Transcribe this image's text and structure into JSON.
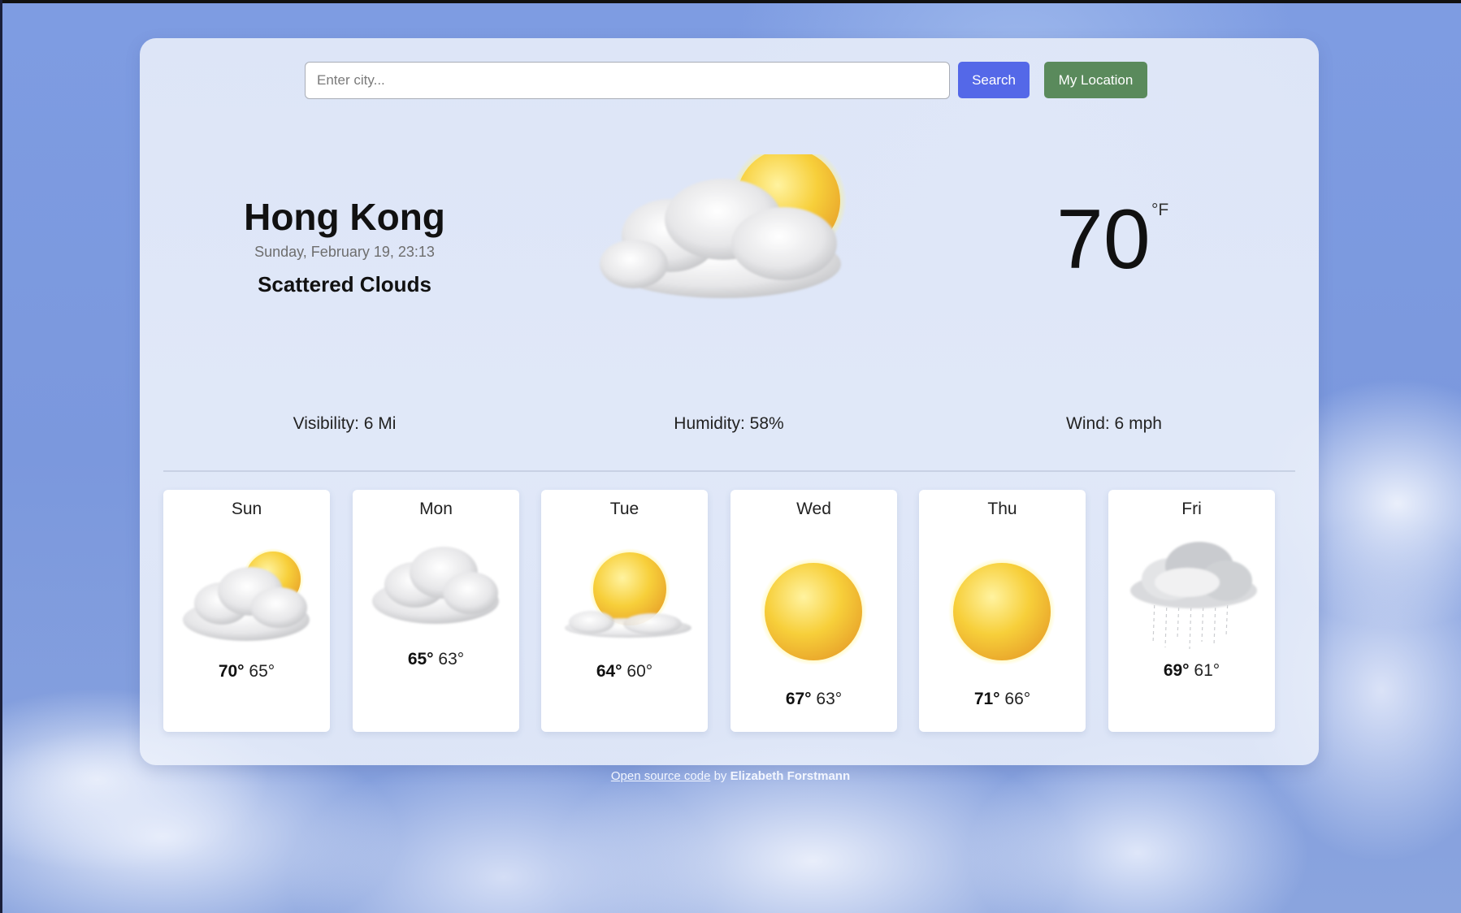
{
  "search": {
    "placeholder": "Enter city...",
    "value": "",
    "search_label": "Search",
    "location_label": "My Location"
  },
  "current": {
    "city": "Hong Kong",
    "datetime": "Sunday, February 19, 23:13",
    "description": "Scattered Clouds",
    "icon": "sun-behind-cloud-icon",
    "temperature": "70",
    "unit": "°F"
  },
  "details": {
    "visibility": "Visibility: 6 Mi",
    "humidity": "Humidity: 58%",
    "wind": "Wind: 6 mph"
  },
  "forecast": [
    {
      "day": "Sun",
      "icon": "sun-behind-cloud-icon",
      "max": "70°",
      "min": "65°"
    },
    {
      "day": "Mon",
      "icon": "cloud-icon",
      "max": "65°",
      "min": "63°"
    },
    {
      "day": "Tue",
      "icon": "sun-behind-small-cloud-icon",
      "max": "64°",
      "min": "60°"
    },
    {
      "day": "Wed",
      "icon": "sun-icon",
      "max": "67°",
      "min": "63°"
    },
    {
      "day": "Thu",
      "icon": "sun-icon",
      "max": "71°",
      "min": "66°"
    },
    {
      "day": "Fri",
      "icon": "rain-cloud-icon",
      "max": "69°",
      "min": "61°"
    }
  ],
  "footer": {
    "link_text": "Open source code",
    "by_text": " by ",
    "author": "Elizabeth Forstmann"
  },
  "colors": {
    "search_button": "#5468e8",
    "location_button": "#5a8a5c"
  }
}
